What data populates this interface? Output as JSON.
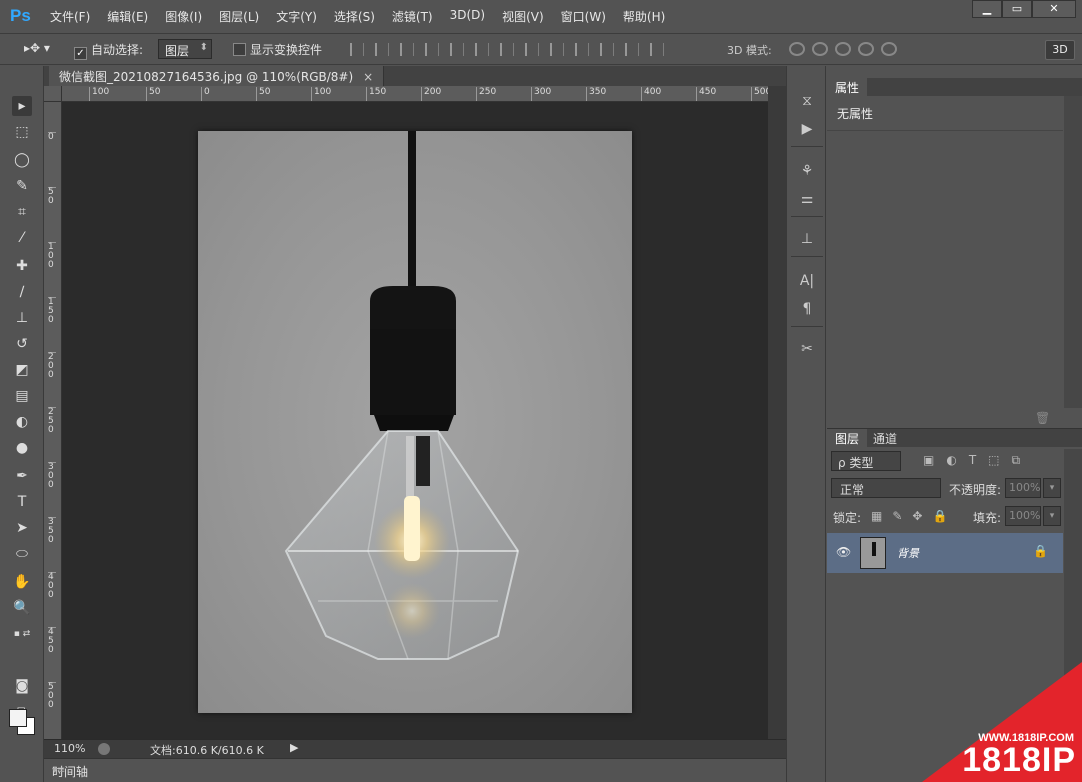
{
  "app": {
    "logo": "Ps"
  },
  "menu": [
    "文件(F)",
    "编辑(E)",
    "图像(I)",
    "图层(L)",
    "文字(Y)",
    "选择(S)",
    "滤镜(T)",
    "3D(D)",
    "视图(V)",
    "窗口(W)",
    "帮助(H)"
  ],
  "window_controls": {
    "minimize": "▁",
    "maximize": "▭",
    "close": "✕"
  },
  "options": {
    "auto_select_label": "自动选择:",
    "auto_select_checked": "✓",
    "auto_select_value": "图层",
    "show_transform_label": "显示变换控件",
    "mode_3d_label": "3D 模式:",
    "btn_3d": "3D"
  },
  "document": {
    "tab_title": "微信截图_20210827164536.jpg @ 110%(RGB/8#)",
    "close": "×",
    "ruler_h": [
      "100",
      "50",
      "0",
      "50",
      "100",
      "150",
      "200",
      "250",
      "300",
      "350",
      "400",
      "450",
      "500"
    ],
    "ruler_v": [
      "0",
      "50",
      "100",
      "150",
      "200",
      "250",
      "300",
      "350",
      "400",
      "450",
      "500"
    ]
  },
  "status": {
    "zoom": "110%",
    "docinfo": "文档:610.6 K/610.6 K",
    "arrow": "▶"
  },
  "timeline": {
    "label": "时间轴",
    "menu": "▾≡"
  },
  "properties": {
    "tab": "属性",
    "content": "无属性",
    "trash": "🗑"
  },
  "layers_panel": {
    "tabs": [
      "图层",
      "通道"
    ],
    "filter": "ρ 类型",
    "blend_mode": "正常",
    "opacity_label": "不透明度:",
    "opacity_value": "100%",
    "lock_label": "锁定:",
    "fill_label": "填充:",
    "fill_value": "100%",
    "layer": {
      "name": "背景",
      "eye": "👁",
      "lock": "🔒"
    }
  },
  "watermark": {
    "url": "WWW.1818IP.COM",
    "brand": "1818IP"
  }
}
